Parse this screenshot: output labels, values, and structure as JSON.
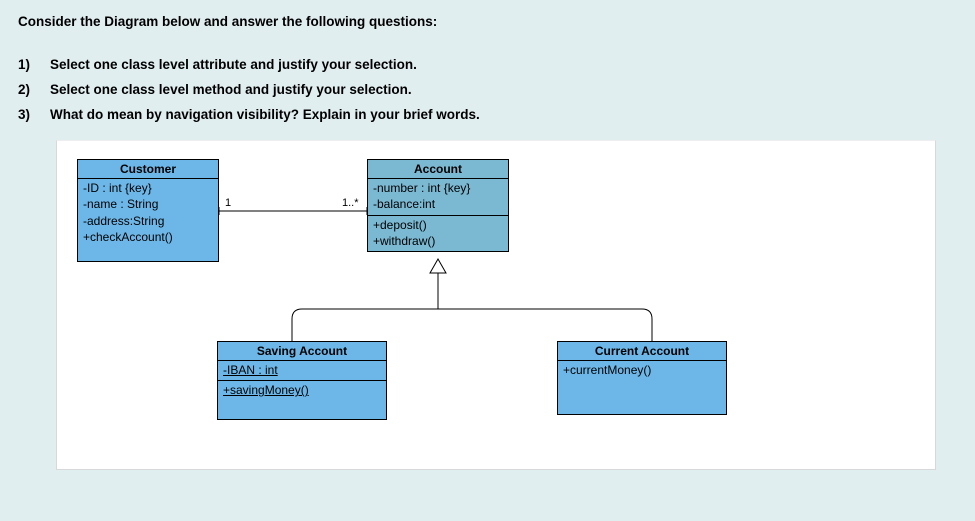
{
  "heading": "Consider the Diagram below and answer the following questions:",
  "questions": [
    {
      "n": "1)",
      "t": "Select one class level attribute and justify your selection."
    },
    {
      "n": "2)",
      "t": "Select one class level method and justify your selection."
    },
    {
      "n": "3)",
      "t": "What do mean by navigation visibility? Explain in your brief words."
    }
  ],
  "uml": {
    "association": {
      "leftMult": "1",
      "rightMult": "1..*"
    },
    "classes": {
      "customer": {
        "name": "Customer",
        "attrs": [
          "-ID : int {key}",
          "-name : String",
          "-address:String"
        ],
        "ops": [
          "+checkAccount()"
        ]
      },
      "account": {
        "name": "Account",
        "attrs": [
          "-number : int {key}",
          "-balance:int"
        ],
        "ops": [
          "+deposit()",
          "+withdraw()"
        ]
      },
      "saving": {
        "name": "Saving Account",
        "attrs": [
          "-IBAN : int"
        ],
        "ops": [
          "+savingMoney()"
        ]
      },
      "current": {
        "name": "Current Account",
        "attrs": [],
        "ops": [
          "+currentMoney()"
        ]
      }
    }
  }
}
